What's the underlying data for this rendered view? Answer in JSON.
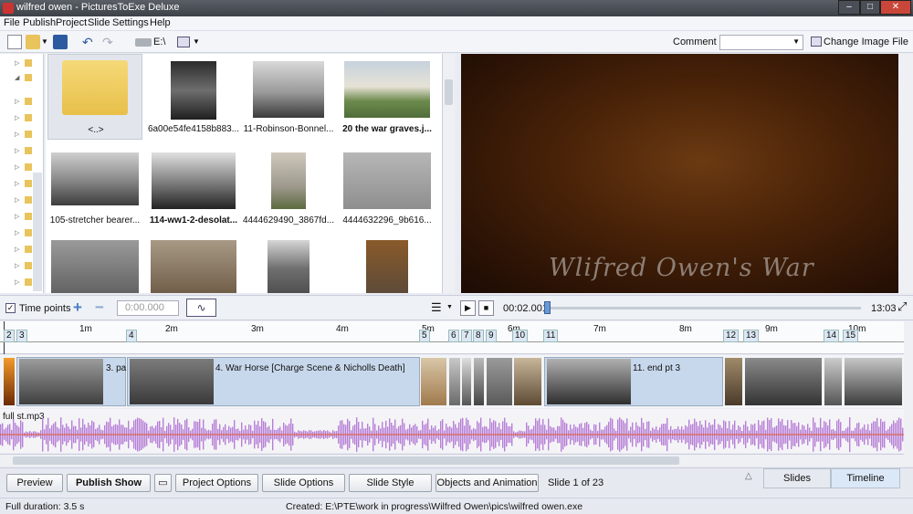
{
  "window": {
    "title": "wilfred owen - PicturesToExe Deluxe"
  },
  "menu": [
    "File",
    "Publish",
    "Project",
    "Slide",
    "Settings",
    "Help"
  ],
  "toolbar": {
    "drive_label": "E:\\",
    "comment_label": "Comment",
    "change_image_label": "Change Image File"
  },
  "thumbnails": [
    {
      "caption": "<..>"
    },
    {
      "caption": "6a00e54fe4158b883..."
    },
    {
      "caption": "11-Robinson-Bonnel..."
    },
    {
      "caption": "20 the war graves.j..."
    },
    {
      "caption": "105-stretcher bearer..."
    },
    {
      "caption": "114-ww1-2-desolat..."
    },
    {
      "caption": "4444629490_3867fd..."
    },
    {
      "caption": "4444632296_9b616..."
    },
    {
      "caption": ""
    },
    {
      "caption": ""
    },
    {
      "caption": ""
    },
    {
      "caption": ""
    }
  ],
  "preview": {
    "overlay_text": "Wlifred Owen's War"
  },
  "controls": {
    "time_points_label": "Time points",
    "time_value": "0:00.000",
    "position": "00:02.001",
    "total": "13:03",
    "progress": 0.003
  },
  "timeline": {
    "minute_labels": [
      "1m",
      "2m",
      "3m",
      "4m",
      "5m",
      "6m",
      "7m",
      "8m",
      "9m",
      "10m"
    ],
    "slide_numbers": [
      "2",
      "3",
      "4",
      "5",
      "6",
      "7",
      "8",
      "9",
      "10",
      "11",
      "12",
      "13",
      "14",
      "15"
    ],
    "segment_labels": [
      "3. pa:",
      "4. War Horse [Charge Scene & Nicholls Death]",
      "11. end pt 3"
    ],
    "audio_label": "full st.mp3"
  },
  "buttons": {
    "preview": "Preview",
    "publish": "Publish Show",
    "project_options": "Project Options",
    "slide_options": "Slide Options",
    "slide_style": "Slide Style",
    "objects": "Objects and Animation",
    "slide_count": "Slide 1 of 23",
    "tab_slides": "Slides",
    "tab_timeline": "Timeline"
  },
  "status": {
    "duration": "Full duration: 3.5 s",
    "created": "Created: E:\\PTE\\work in progress\\Wilfred Owen\\pics\\wilfred owen.exe"
  }
}
